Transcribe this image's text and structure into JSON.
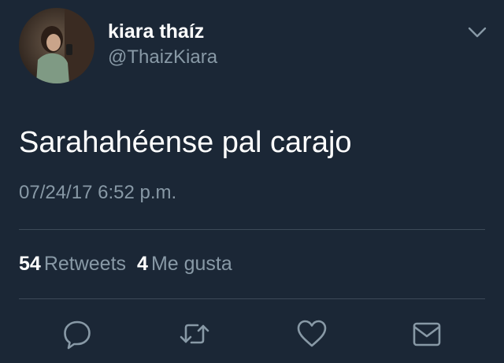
{
  "tweet": {
    "author_name": "kiara thaíz",
    "author_handle": "@ThaizKiara",
    "text": "Sarahahéense pal carajo",
    "timestamp": "07/24/17 6:52 p.m.",
    "retweet_count": "54",
    "retweet_label": "Retweets",
    "like_count": "4",
    "like_label": "Me gusta"
  },
  "icons": {
    "menu": "chevron-down-icon",
    "reply": "reply-icon",
    "retweet": "retweet-icon",
    "like": "heart-icon",
    "message": "envelope-icon"
  },
  "colors": {
    "background": "#1b2736",
    "secondary_text": "#8899a6",
    "primary_text": "#ffffff",
    "divider": "#3d4a58"
  }
}
